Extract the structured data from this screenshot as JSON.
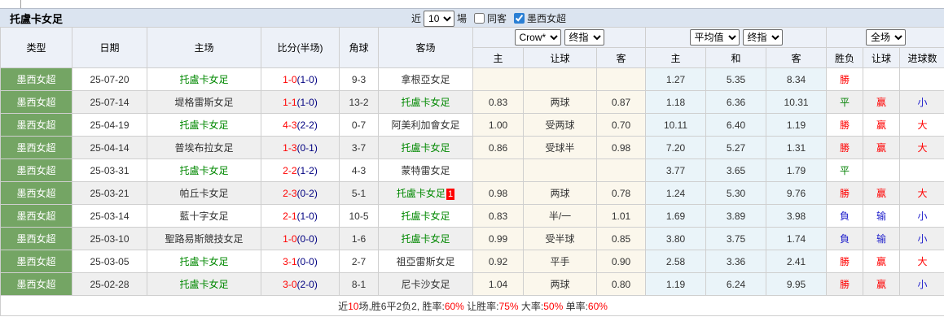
{
  "top": {
    "title": "托盧卡女足",
    "near_label": "近",
    "count_select": "10",
    "games_label": "場",
    "same_away_label": "同客",
    "league_filter_label": "墨西女超"
  },
  "header": {
    "type": "类型",
    "date": "日期",
    "home": "主场",
    "score": "比分(半场)",
    "corner": "角球",
    "away": "客场",
    "group1": {
      "select1": "Crow*",
      "select2": "终指",
      "cols": [
        "主",
        "让球",
        "客"
      ]
    },
    "group2": {
      "select1": "平均值",
      "select2": "终指",
      "cols": [
        "主",
        "和",
        "客"
      ]
    },
    "group3": {
      "select1": "全场",
      "cols": [
        "胜负",
        "让球",
        "进球数"
      ]
    }
  },
  "rows": [
    {
      "league": "墨西女超",
      "date": "25-07-20",
      "home": "托盧卡女足",
      "home_hl": true,
      "score": "1-0",
      "half": "(1-0)",
      "corner": "9-3",
      "away": "拿根亞女足",
      "away_hl": false,
      "badge": "",
      "o1": "",
      "hcp": "",
      "o2": "",
      "a1": "1.27",
      "a2": "5.35",
      "a3": "8.34",
      "res": "勝",
      "hres": "",
      "goals": ""
    },
    {
      "league": "墨西女超",
      "date": "25-07-14",
      "home": "堤格雷斯女足",
      "home_hl": false,
      "score": "1-1",
      "half": "(1-0)",
      "corner": "13-2",
      "away": "托盧卡女足",
      "away_hl": true,
      "badge": "",
      "o1": "0.83",
      "hcp": "两球",
      "o2": "0.87",
      "a1": "1.18",
      "a2": "6.36",
      "a3": "10.31",
      "res": "平",
      "hres": "赢",
      "goals": "小"
    },
    {
      "league": "墨西女超",
      "date": "25-04-19",
      "home": "托盧卡女足",
      "home_hl": true,
      "score": "4-3",
      "half": "(2-2)",
      "corner": "0-7",
      "away": "阿美利加會女足",
      "away_hl": false,
      "badge": "",
      "o1": "1.00",
      "hcp": "受两球",
      "o2": "0.70",
      "a1": "10.11",
      "a2": "6.40",
      "a3": "1.19",
      "res": "勝",
      "hres": "赢",
      "goals": "大"
    },
    {
      "league": "墨西女超",
      "date": "25-04-14",
      "home": "普埃布拉女足",
      "home_hl": false,
      "score": "1-3",
      "half": "(0-1)",
      "corner": "3-7",
      "away": "托盧卡女足",
      "away_hl": true,
      "badge": "",
      "o1": "0.86",
      "hcp": "受球半",
      "o2": "0.98",
      "a1": "7.20",
      "a2": "5.27",
      "a3": "1.31",
      "res": "勝",
      "hres": "赢",
      "goals": "大"
    },
    {
      "league": "墨西女超",
      "date": "25-03-31",
      "home": "托盧卡女足",
      "home_hl": true,
      "score": "2-2",
      "half": "(1-2)",
      "corner": "4-3",
      "away": "蒙特雷女足",
      "away_hl": false,
      "badge": "",
      "o1": "",
      "hcp": "",
      "o2": "",
      "a1": "3.77",
      "a2": "3.65",
      "a3": "1.79",
      "res": "平",
      "hres": "",
      "goals": ""
    },
    {
      "league": "墨西女超",
      "date": "25-03-21",
      "home": "帕丘卡女足",
      "home_hl": false,
      "score": "2-3",
      "half": "(0-2)",
      "corner": "5-1",
      "away": "托盧卡女足",
      "away_hl": true,
      "badge": "1",
      "o1": "0.98",
      "hcp": "两球",
      "o2": "0.78",
      "a1": "1.24",
      "a2": "5.30",
      "a3": "9.76",
      "res": "勝",
      "hres": "赢",
      "goals": "大"
    },
    {
      "league": "墨西女超",
      "date": "25-03-14",
      "home": "藍十字女足",
      "home_hl": false,
      "score": "2-1",
      "half": "(1-0)",
      "corner": "10-5",
      "away": "托盧卡女足",
      "away_hl": true,
      "badge": "",
      "o1": "0.83",
      "hcp": "半/一",
      "o2": "1.01",
      "a1": "1.69",
      "a2": "3.89",
      "a3": "3.98",
      "res": "負",
      "hres": "输",
      "goals": "小"
    },
    {
      "league": "墨西女超",
      "date": "25-03-10",
      "home": "聖路易斯競技女足",
      "home_hl": false,
      "score": "1-0",
      "half": "(0-0)",
      "corner": "1-6",
      "away": "托盧卡女足",
      "away_hl": true,
      "badge": "",
      "o1": "0.99",
      "hcp": "受半球",
      "o2": "0.85",
      "a1": "3.80",
      "a2": "3.75",
      "a3": "1.74",
      "res": "負",
      "hres": "输",
      "goals": "小"
    },
    {
      "league": "墨西女超",
      "date": "25-03-05",
      "home": "托盧卡女足",
      "home_hl": true,
      "score": "3-1",
      "half": "(0-0)",
      "corner": "2-7",
      "away": "祖亞雷斯女足",
      "away_hl": false,
      "badge": "",
      "o1": "0.92",
      "hcp": "平手",
      "o2": "0.90",
      "a1": "2.58",
      "a2": "3.36",
      "a3": "2.41",
      "res": "勝",
      "hres": "赢",
      "goals": "大"
    },
    {
      "league": "墨西女超",
      "date": "25-02-28",
      "home": "托盧卡女足",
      "home_hl": true,
      "score": "3-0",
      "half": "(2-0)",
      "corner": "8-1",
      "away": "尼卡沙女足",
      "away_hl": false,
      "badge": "",
      "o1": "1.04",
      "hcp": "两球",
      "o2": "0.80",
      "a1": "1.19",
      "a2": "6.24",
      "a3": "9.95",
      "res": "勝",
      "hres": "赢",
      "goals": "小"
    }
  ],
  "footer": {
    "parts": [
      {
        "t": "近",
        "c": "dark"
      },
      {
        "t": "10",
        "c": "red"
      },
      {
        "t": "场,胜6平2负2, 胜率:",
        "c": "dark"
      },
      {
        "t": "60%",
        "c": "red"
      },
      {
        "t": " 让胜率:",
        "c": "dark"
      },
      {
        "t": "75%",
        "c": "red"
      },
      {
        "t": " 大率:",
        "c": "dark"
      },
      {
        "t": "50%",
        "c": "red"
      },
      {
        "t": " 单率:",
        "c": "dark"
      },
      {
        "t": "60%",
        "c": "red"
      }
    ]
  },
  "colors": {
    "league_cell_bg": "#74a564",
    "odds_col_bg": "#fbf7ec",
    "avg_col_bg": "#eaf4f9",
    "titlebar_bg": "#dbe4f0",
    "header_bg": "#edf1f8",
    "win": "#ff0000",
    "draw": "#008000",
    "lose": "#2222cc",
    "team_highlight": "#008800",
    "score_main": "#ff0000",
    "score_half": "#000080"
  }
}
